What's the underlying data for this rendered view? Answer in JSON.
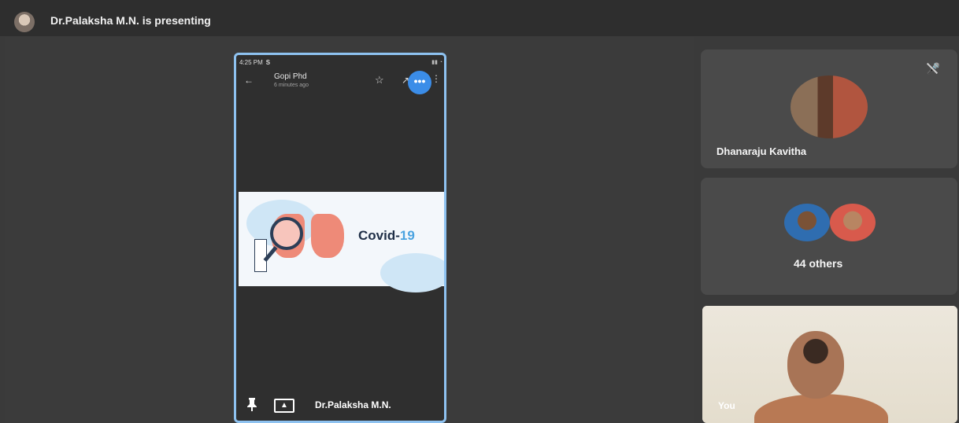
{
  "presentation_bar": {
    "title": "Dr.Palaksha M.N. is presenting"
  },
  "shared_screen": {
    "status_time": "4:25 PM",
    "status_app_icon": "S",
    "app_title": "Gopi Phd",
    "app_subtitle": "6 minutes ago",
    "content_title": "Covid-19",
    "back_icon": "←",
    "star_icon": "☆",
    "share_icon": "↗",
    "more_icon": "•••",
    "kebab_icon": "⋮"
  },
  "presenter_bar": {
    "pin_icon": "📌",
    "presenter_name": "Dr.Palaksha M.N."
  },
  "participants": {
    "tile1": {
      "name": "Dhanaraju Kavitha",
      "muted": true
    },
    "tile2": {
      "label": "44 others"
    },
    "tile3": {
      "label": "You"
    }
  },
  "colors": {
    "background": "#3a3a3a",
    "tile": "#4a4a4a",
    "accent_blue": "#3b8de8",
    "screen_border": "#8ec2f0"
  }
}
